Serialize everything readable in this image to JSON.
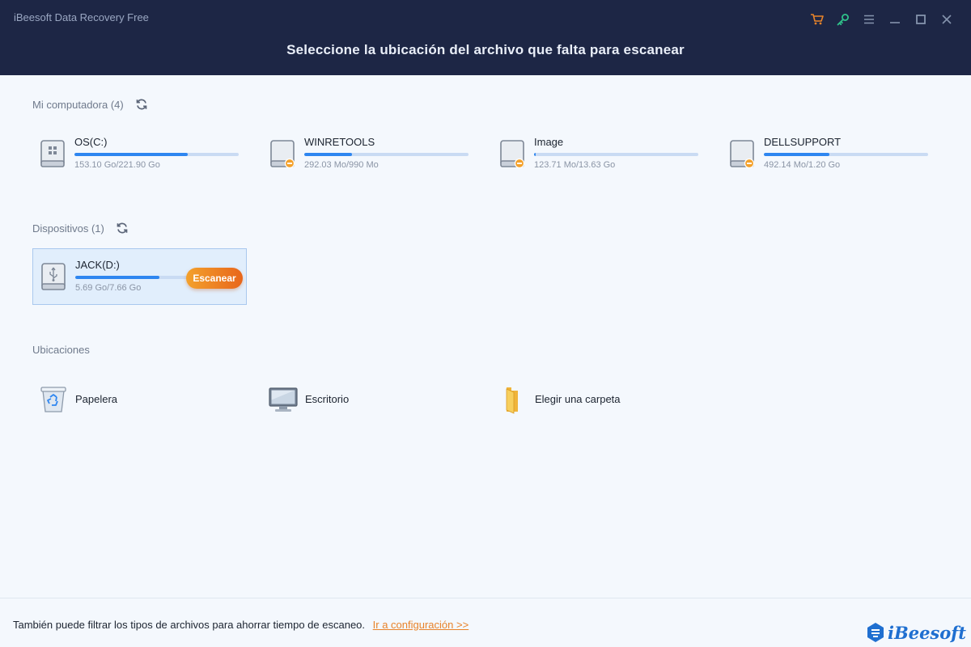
{
  "window": {
    "title": "iBeesoft Data Recovery Free",
    "headline": "Seleccione la ubicación del archivo que falta para escanear",
    "controls": [
      "cart-icon",
      "key-icon",
      "menu-icon",
      "minimize-icon",
      "maximize-icon",
      "close-icon"
    ],
    "colors": {
      "header_bg": "#1d2645",
      "cart": "#e8832a",
      "key": "#2fc28a",
      "accent": "#2e86f0"
    }
  },
  "computer": {
    "title": "Mi computadora (4)",
    "drives": [
      {
        "name": "OS(C:)",
        "size": "153.10 Go/221.90 Go",
        "used_fraction": 0.69,
        "icon": "windows-drive-icon"
      },
      {
        "name": "WINRETOOLS",
        "size": "292.03 Mo/990 Mo",
        "used_fraction": 0.29,
        "icon": "drive-warning-icon"
      },
      {
        "name": "Image",
        "size": "123.71 Mo/13.63 Go",
        "used_fraction": 0.01,
        "icon": "drive-warning-icon"
      },
      {
        "name": "DELLSUPPORT",
        "size": "492.14 Mo/1.20 Go",
        "used_fraction": 0.4,
        "icon": "drive-warning-icon"
      }
    ]
  },
  "devices": {
    "title": "Dispositivos (1)",
    "items": [
      {
        "name": "JACK(D:)",
        "size": "5.69 Go/7.66 Go",
        "used_fraction": 0.74,
        "icon": "usb-drive-icon",
        "scan_label": "Escanear"
      }
    ]
  },
  "locations": {
    "title": "Ubicaciones",
    "items": [
      {
        "label": "Papelera",
        "icon": "recycle-bin-icon"
      },
      {
        "label": "Escritorio",
        "icon": "desktop-icon"
      },
      {
        "label": "Elegir una carpeta",
        "icon": "folder-icon"
      }
    ]
  },
  "footer": {
    "text": "También puede filtrar los tipos de archivos para ahorrar tiempo de escaneo.",
    "link": "Ir a configuración >>",
    "brand": "iBeesoft"
  }
}
